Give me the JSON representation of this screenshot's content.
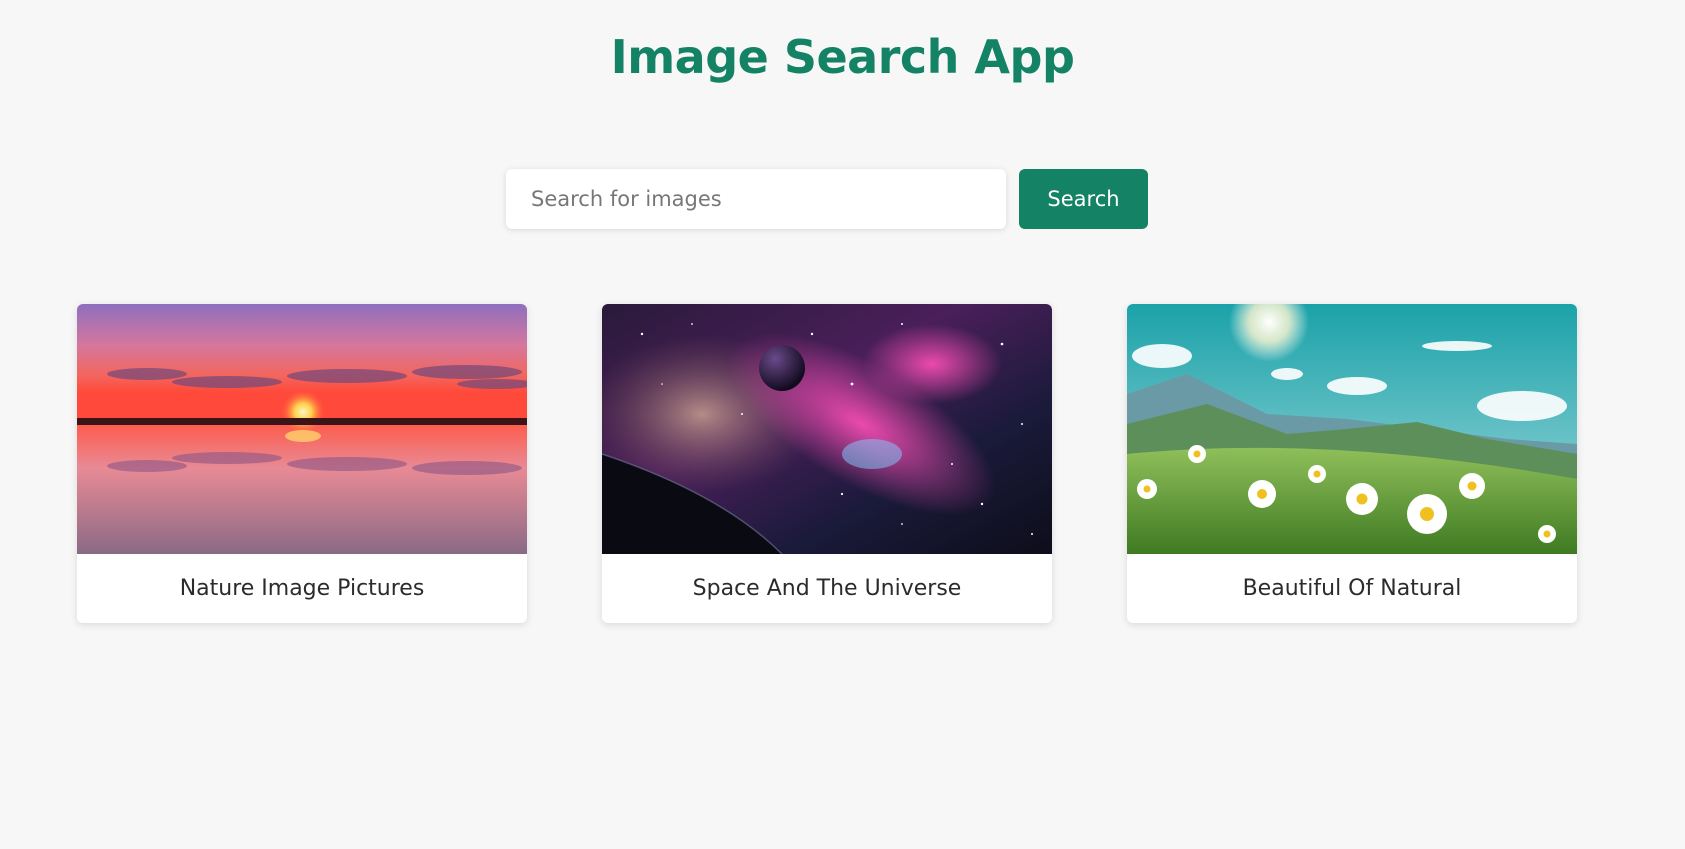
{
  "app": {
    "title": "Image Search App",
    "accent_color": "#148264"
  },
  "search": {
    "placeholder": "Search for images",
    "value": "",
    "button_label": "Search"
  },
  "results": [
    {
      "title": "Nature Image Pictures",
      "image": "sunset-lake-reflection"
    },
    {
      "title": "Space And The Universe",
      "image": "galaxy-nebula-planet"
    },
    {
      "title": "Beautiful Of Natural",
      "image": "daisy-meadow-mountains"
    }
  ]
}
